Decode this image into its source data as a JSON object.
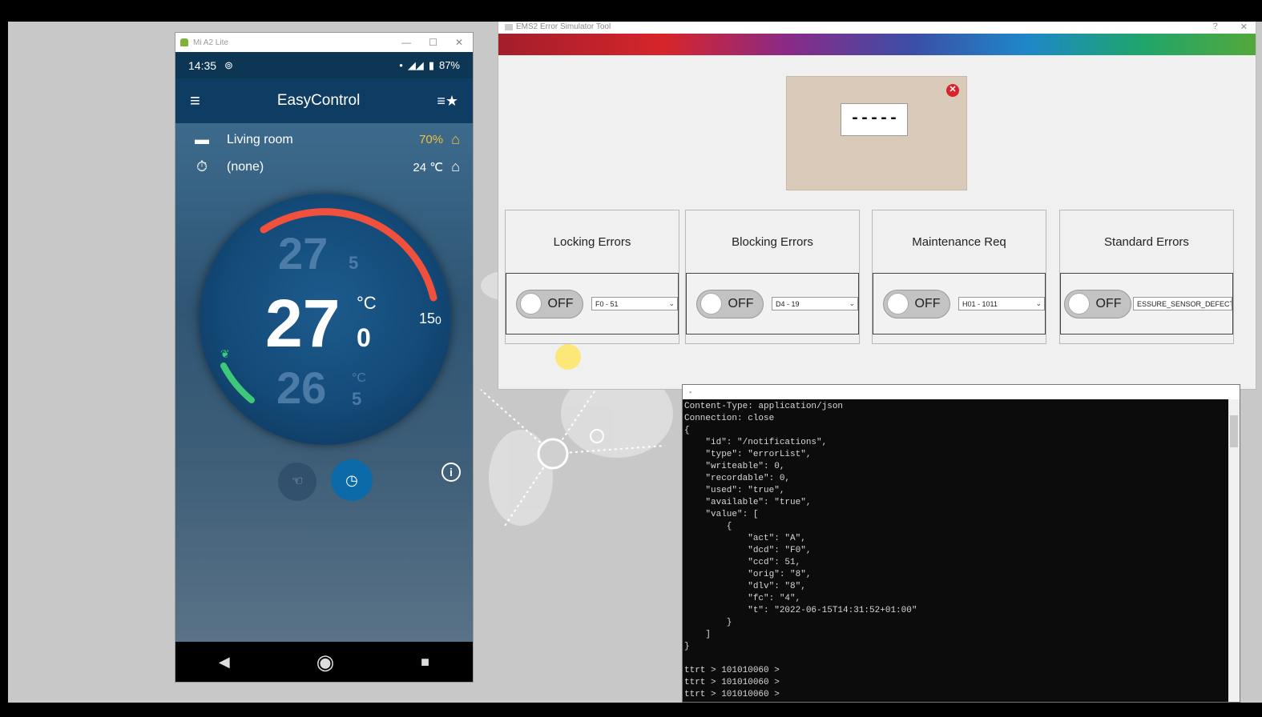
{
  "phone_window": {
    "title": "Mi A2 Lite",
    "status": {
      "time": "14:35",
      "battery": "87%"
    },
    "app": {
      "title": "EasyControl",
      "room_name": "Living room",
      "humidity": "70%",
      "schedule": "(none)",
      "outside_temp": "24 ℃",
      "dial": {
        "upper_temp_int": "27",
        "upper_temp_dec": "5",
        "current_temp_int": "27",
        "current_temp_dec": "0",
        "unit": "°C",
        "lower_temp_int": "26",
        "lower_temp_dec": "5",
        "lower_unit": "°C",
        "side_value_int": "15",
        "side_value_dec": "0"
      }
    }
  },
  "ems_window": {
    "title": "EMS2 Error Simulator Tool",
    "display_code": "-----",
    "panels": [
      {
        "title": "Locking Errors",
        "toggle": "OFF",
        "select": "F0 - 51"
      },
      {
        "title": "Blocking Errors",
        "toggle": "OFF",
        "select": "D4 - 19"
      },
      {
        "title": "Maintenance Req",
        "toggle": "OFF",
        "select": "H01 - 1011"
      },
      {
        "title": "Standard Errors",
        "toggle": "OFF",
        "select": "ESSURE_SENSOR_DEFECT"
      }
    ]
  },
  "console_window": {
    "lines": [
      "Content-Type: application/json",
      "Connection: close",
      "{",
      "    \"id\": \"/notifications\",",
      "    \"type\": \"errorList\",",
      "    \"writeable\": 0,",
      "    \"recordable\": 0,",
      "    \"used\": \"true\",",
      "    \"available\": \"true\",",
      "    \"value\": [",
      "        {",
      "            \"act\": \"A\",",
      "            \"dcd\": \"F0\",",
      "            \"ccd\": 51,",
      "            \"orig\": \"8\",",
      "            \"dlv\": \"8\",",
      "            \"fc\": \"4\",",
      "            \"t\": \"2022-06-15T14:31:52+01:00\"",
      "        }",
      "    ]",
      "}",
      "",
      "ttrt > 101010060 >",
      "ttrt > 101010060 >",
      "ttrt > 101010060 >"
    ]
  }
}
